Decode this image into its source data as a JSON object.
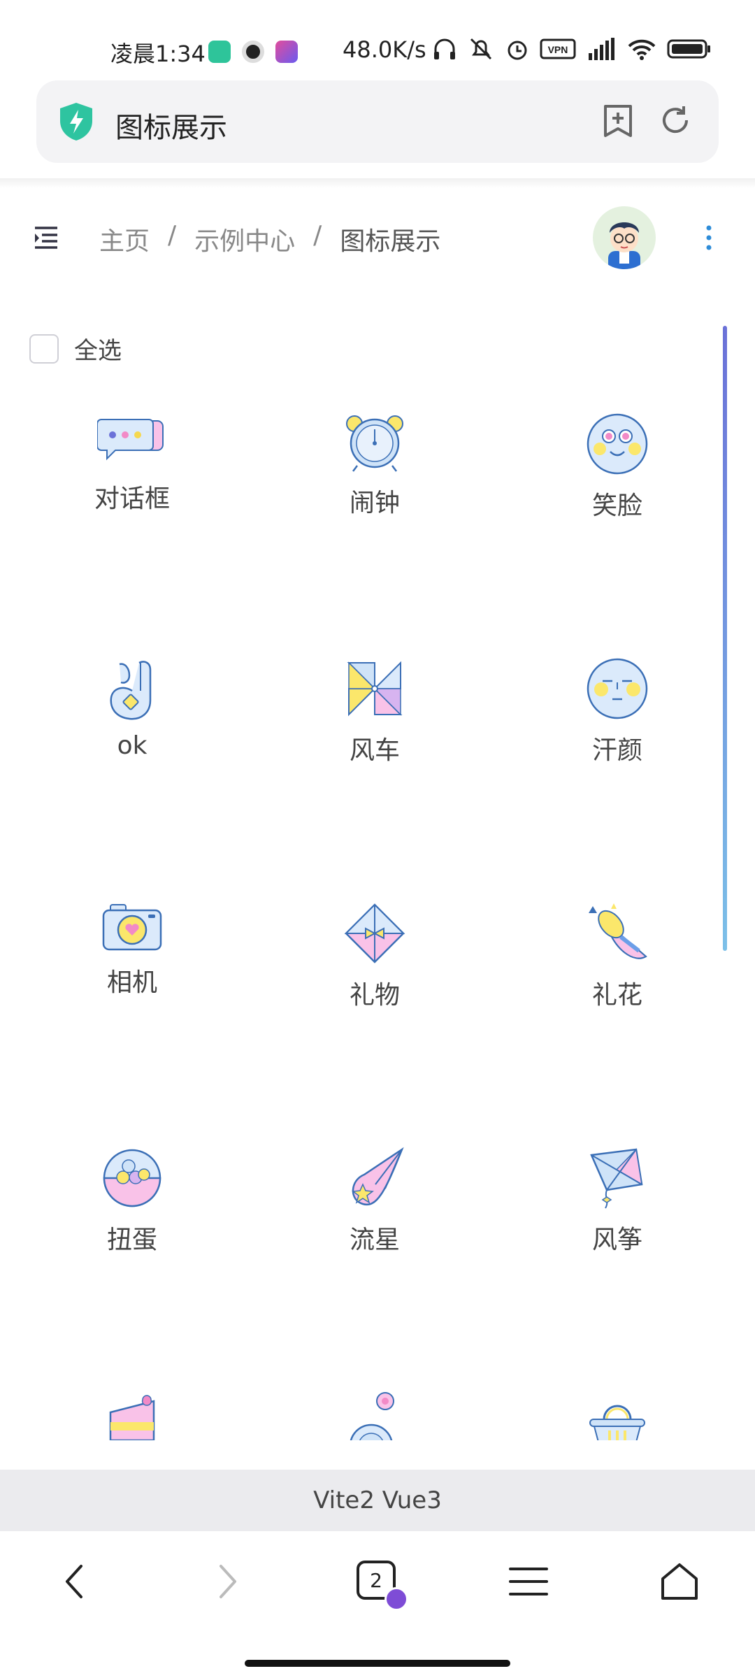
{
  "status_bar": {
    "time": "凌晨1:34",
    "speed": "48.0K/s"
  },
  "address_bar": {
    "title": "图标展示"
  },
  "breadcrumb": [
    "主页",
    "示例中心",
    "图标展示"
  ],
  "select_all_label": "全选",
  "icons": [
    {
      "label": "对话框",
      "icon": "chat-bubbles-icon"
    },
    {
      "label": "闹钟",
      "icon": "alarm-clock-icon"
    },
    {
      "label": "笑脸",
      "icon": "smiley-face-icon"
    },
    {
      "label": "ok",
      "icon": "ok-hand-icon"
    },
    {
      "label": "风车",
      "icon": "pinwheel-icon"
    },
    {
      "label": "汗颜",
      "icon": "sweat-face-icon"
    },
    {
      "label": "相机",
      "icon": "camera-icon"
    },
    {
      "label": "礼物",
      "icon": "gift-icon"
    },
    {
      "label": "礼花",
      "icon": "party-popper-icon"
    },
    {
      "label": "扭蛋",
      "icon": "gacha-capsule-icon"
    },
    {
      "label": "流星",
      "icon": "shooting-star-icon"
    },
    {
      "label": "风筝",
      "icon": "kite-icon"
    }
  ],
  "footer_text": "Vite2 Vue3",
  "tab_count": "2",
  "colors": {
    "accent": "#6b71d8",
    "pink": "#f9b8e6",
    "yellow": "#fbe76b",
    "blue_line": "#3b6fb6",
    "light_blue": "#cfe3f8"
  }
}
